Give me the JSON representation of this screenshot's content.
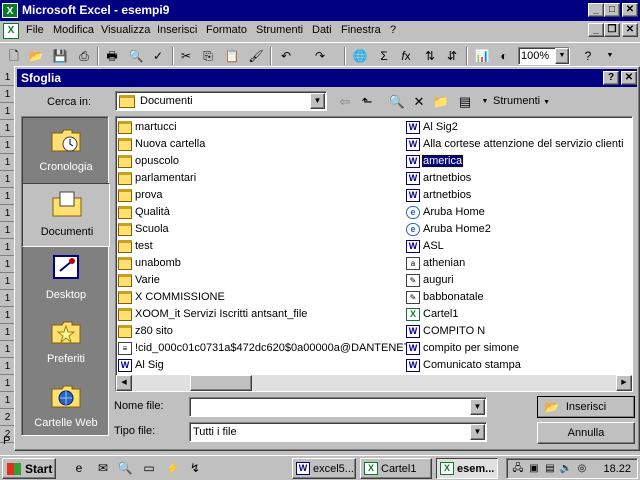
{
  "excel": {
    "title": "Microsoft Excel - esempi9",
    "menu": [
      "File",
      "Modifica",
      "Visualizza",
      "Inserisci",
      "Formato",
      "Strumenti",
      "Dati",
      "Finestra",
      "?"
    ],
    "zoom": "100%",
    "row_numbers": [
      "1",
      "1",
      "1",
      "1",
      "1",
      "1",
      "1",
      "1",
      "1",
      "1",
      "1",
      "1",
      "1",
      "1",
      "1",
      "1",
      "1",
      "1",
      "1",
      "1",
      "2",
      "2"
    ],
    "sheet_tab_hint": "P"
  },
  "dialog": {
    "title": "Sfoglia",
    "look_in_label": "Cerca in:",
    "look_in_value": "Documenti",
    "tools_label": "Strumenti",
    "places": [
      {
        "label": "Cronologia",
        "icon": "history-folder-icon",
        "active": false
      },
      {
        "label": "Documenti",
        "icon": "documents-folder-icon",
        "active": true
      },
      {
        "label": "Desktop",
        "icon": "desktop-icon",
        "active": false
      },
      {
        "label": "Preferiti",
        "icon": "favorites-folder-icon",
        "active": false
      },
      {
        "label": "Cartelle Web",
        "icon": "web-folders-icon",
        "active": false
      }
    ],
    "files_col1": [
      {
        "name": "martucci",
        "type": "folder"
      },
      {
        "name": "Nuova cartella",
        "type": "folder"
      },
      {
        "name": "opuscolo",
        "type": "folder"
      },
      {
        "name": "parlamentari",
        "type": "folder"
      },
      {
        "name": "prova",
        "type": "folder"
      },
      {
        "name": "Qualità",
        "type": "folder"
      },
      {
        "name": "Scuola",
        "type": "folder"
      },
      {
        "name": "test",
        "type": "folder"
      },
      {
        "name": "unabomb",
        "type": "folder"
      },
      {
        "name": "Varie",
        "type": "folder"
      },
      {
        "name": "X COMMISSIONE",
        "type": "folder"
      },
      {
        "name": "XOOM_it Servizi Iscritti antsant_file",
        "type": "folder"
      },
      {
        "name": "z80 sito",
        "type": "folder"
      },
      {
        "name": "!cid_000c01c0731a$472dc620$0a00000a@DANTENET",
        "type": "generic"
      },
      {
        "name": "Al Sig",
        "type": "word"
      }
    ],
    "files_col2": [
      {
        "name": "Al Sig2",
        "type": "word"
      },
      {
        "name": "Alla cortese attenzione del servizio clienti",
        "type": "word"
      },
      {
        "name": "america",
        "type": "word",
        "selected": true
      },
      {
        "name": "artnetbios",
        "type": "word"
      },
      {
        "name": "artnetbios",
        "type": "word"
      },
      {
        "name": "Aruba Home",
        "type": "web"
      },
      {
        "name": "Aruba Home2",
        "type": "web"
      },
      {
        "name": "ASL",
        "type": "word"
      },
      {
        "name": "athenian",
        "type": "generic"
      },
      {
        "name": "auguri",
        "type": "generic"
      },
      {
        "name": "babbonatale",
        "type": "generic"
      },
      {
        "name": "Cartel1",
        "type": "excel"
      },
      {
        "name": "COMPITO N",
        "type": "word"
      },
      {
        "name": "compito per simone",
        "type": "word"
      },
      {
        "name": "Comunicato stampa",
        "type": "word"
      }
    ],
    "filename_label": "Nome file:",
    "filename_value": "",
    "filetype_label": "Tipo file:",
    "filetype_value": "Tutti i file",
    "open_button": "Inserisci",
    "cancel_button": "Annulla"
  },
  "taskbar": {
    "start": "Start",
    "tasks": [
      {
        "label": "excel5...",
        "active": false
      },
      {
        "label": "Cartel1",
        "active": false
      },
      {
        "label": "esem...",
        "active": true
      }
    ],
    "clock": "18.22"
  }
}
